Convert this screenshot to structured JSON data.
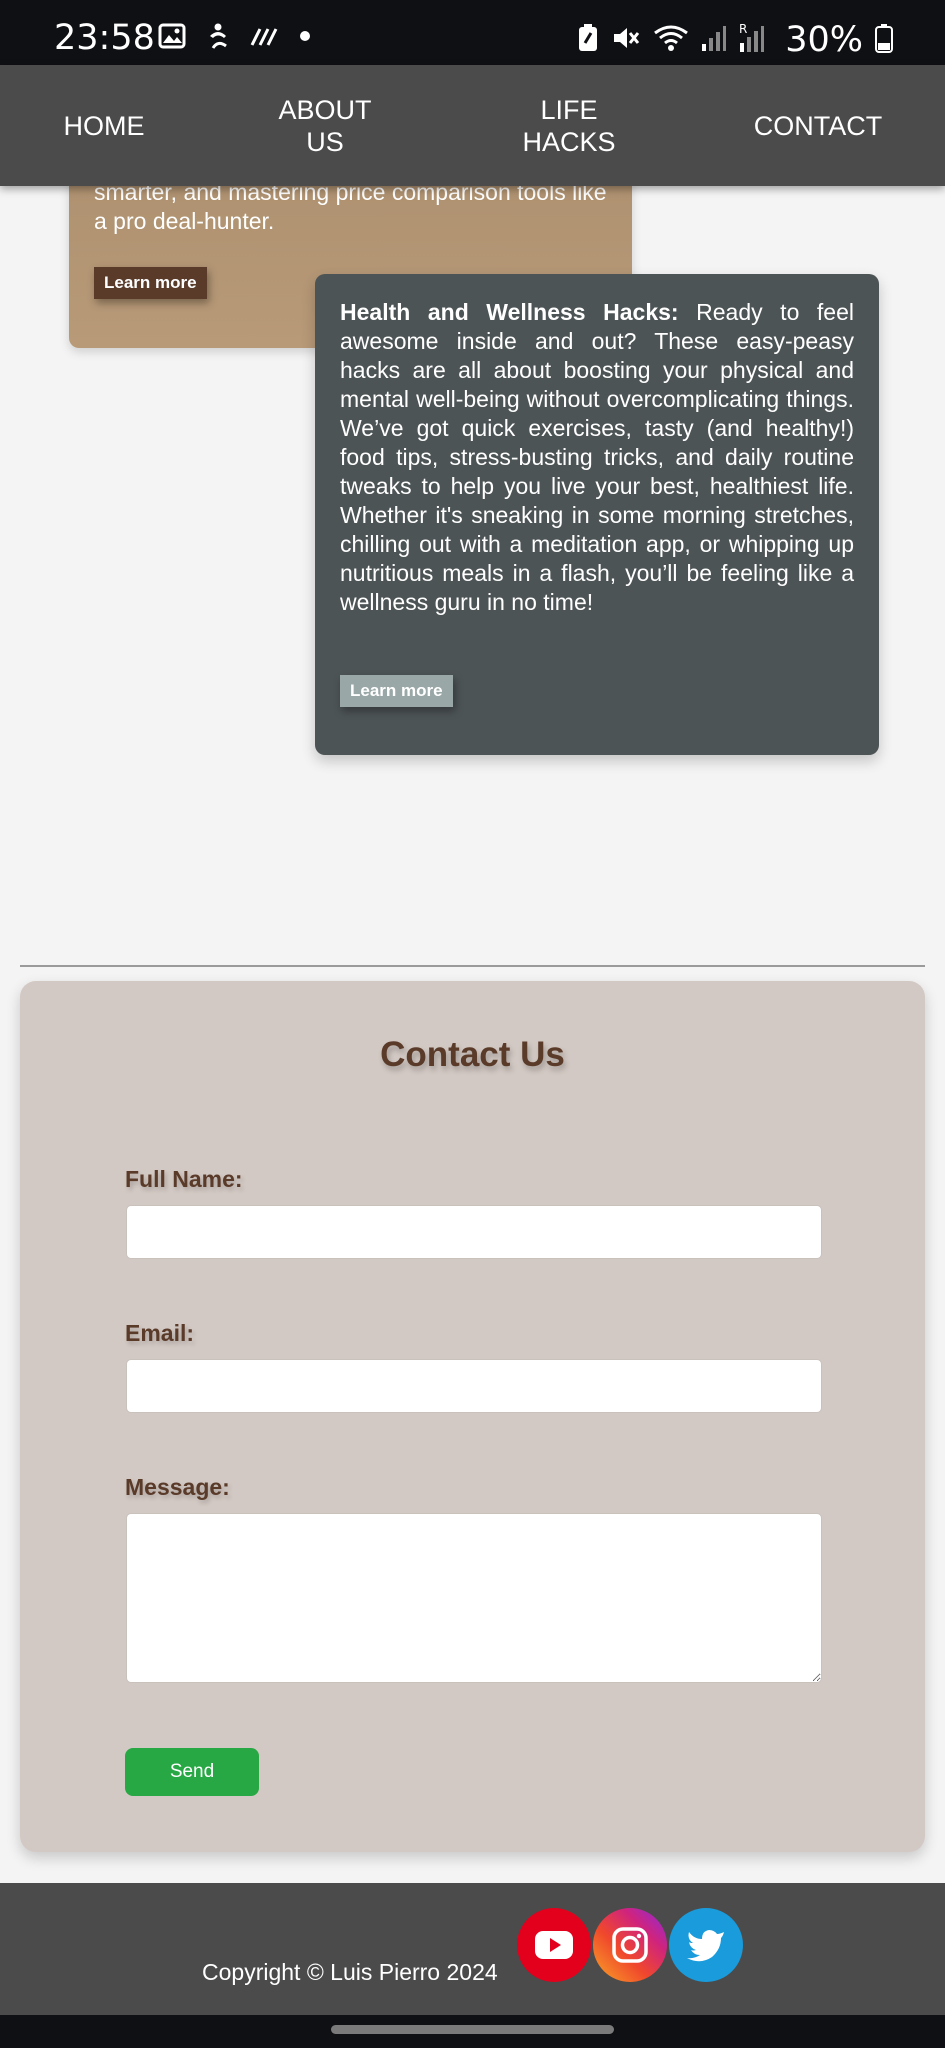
{
  "status_bar": {
    "time": "23:58",
    "battery": "30%",
    "icons": [
      "image-icon",
      "accessibility-icon",
      "stripes-icon",
      "dot-icon",
      "battery-saver-icon",
      "mute-icon",
      "wifi-icon",
      "signal-icon",
      "roaming-signal-icon",
      "battery-icon"
    ]
  },
  "nav": {
    "items": [
      {
        "label": "HOME"
      },
      {
        "label": "ABOUT\nUS"
      },
      {
        "label": "LIFE\nHACKS"
      },
      {
        "label": "CONTACT"
      }
    ]
  },
  "cards": {
    "finance": {
      "text": "smarter, and mastering price comparison tools like a pro deal-hunter.",
      "button": "Learn more",
      "color": "#b08f6e"
    },
    "health": {
      "title": "Health and Wellness Hacks:",
      "text": " Ready to feel awesome inside and out? These easy-peasy hacks are all about boosting your physical and mental well-being without overcomplicating things. We’ve got quick exercises, tasty (and healthy!) food tips, stress-busting tricks, and daily routine tweaks to help you live your best, healthiest life. Whether it's sneaking in some morning stretches, chilling out with a meditation app, or whipping up nutritious meals in a flash, you’ll be feeling like a wellness guru in no time!",
      "button": "Learn more",
      "color": "#4d5456"
    }
  },
  "contact": {
    "title": "Contact Us",
    "full_name_label": "Full Name:",
    "full_name_value": "",
    "email_label": "Email:",
    "email_value": "",
    "message_label": "Message:",
    "message_value": "",
    "send_label": "Send",
    "accent": "#27a844"
  },
  "footer": {
    "copyright": "Copyright © Luis Pierro 2024",
    "social": [
      "youtube-icon",
      "instagram-icon",
      "twitter-icon"
    ]
  }
}
